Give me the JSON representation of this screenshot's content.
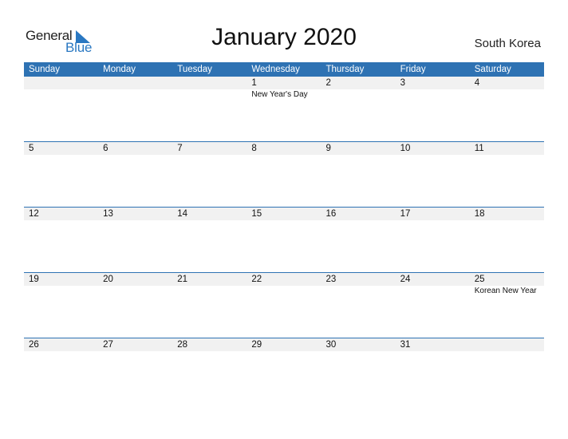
{
  "logo": {
    "word1": "General",
    "word2": "Blue"
  },
  "header": {
    "title": "January 2020",
    "country": "South Korea"
  },
  "colors": {
    "accent": "#2e72b3",
    "strip": "#f1f1f1",
    "logo_blue": "#2a78c2"
  },
  "weekdays": [
    "Sunday",
    "Monday",
    "Tuesday",
    "Wednesday",
    "Thursday",
    "Friday",
    "Saturday"
  ],
  "weeks": [
    {
      "days": [
        "",
        "",
        "",
        "1",
        "2",
        "3",
        "4"
      ],
      "events": [
        "",
        "",
        "",
        "New Year's Day",
        "",
        "",
        ""
      ]
    },
    {
      "days": [
        "5",
        "6",
        "7",
        "8",
        "9",
        "10",
        "11"
      ],
      "events": [
        "",
        "",
        "",
        "",
        "",
        "",
        ""
      ]
    },
    {
      "days": [
        "12",
        "13",
        "14",
        "15",
        "16",
        "17",
        "18"
      ],
      "events": [
        "",
        "",
        "",
        "",
        "",
        "",
        ""
      ]
    },
    {
      "days": [
        "19",
        "20",
        "21",
        "22",
        "23",
        "24",
        "25"
      ],
      "events": [
        "",
        "",
        "",
        "",
        "",
        "",
        "Korean New Year"
      ]
    },
    {
      "days": [
        "26",
        "27",
        "28",
        "29",
        "30",
        "31",
        ""
      ],
      "events": [
        "",
        "",
        "",
        "",
        "",
        "",
        ""
      ]
    }
  ]
}
